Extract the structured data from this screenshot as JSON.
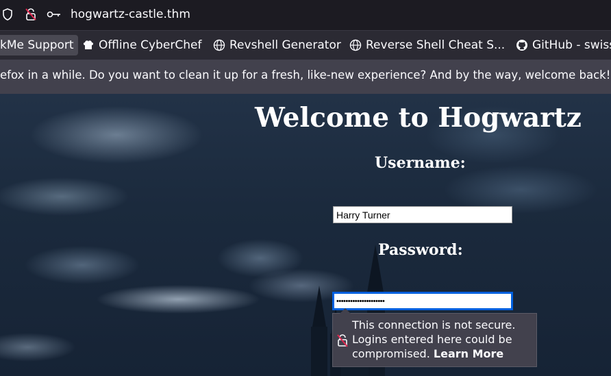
{
  "urlbar": {
    "url": "hogwartz-castle.thm",
    "icons": [
      "shield-icon",
      "insecure-lock-icon",
      "key-icon"
    ]
  },
  "bookmarks": [
    {
      "label": "kMe Support",
      "icon": "none",
      "active": true
    },
    {
      "label": "Offline CyberChef",
      "icon": "chef-hat-icon"
    },
    {
      "label": "Revshell Generator",
      "icon": "globe-icon"
    },
    {
      "label": "Reverse Shell Cheat S...",
      "icon": "globe-icon"
    },
    {
      "label": "GitHub - swiss",
      "icon": "github-icon"
    }
  ],
  "notification": {
    "text": "efox in a while. Do you want to clean it up for a fresh, like-new experience? And by the way, welcome back!"
  },
  "page": {
    "heading": "Welcome to Hogwartz",
    "username_label": "Username:",
    "username_value": "Harry Turner",
    "password_label": "Password:",
    "password_value": "•••••••••••••••••••••"
  },
  "tooltip": {
    "message": "This connection is not secure. Logins entered here could be compromised.",
    "link": "Learn More"
  },
  "colors": {
    "chrome_bg": "#1c1b22",
    "toolbar_bg": "#2b2a33",
    "notice_bg": "#42414d",
    "focus_blue": "#0060df"
  }
}
